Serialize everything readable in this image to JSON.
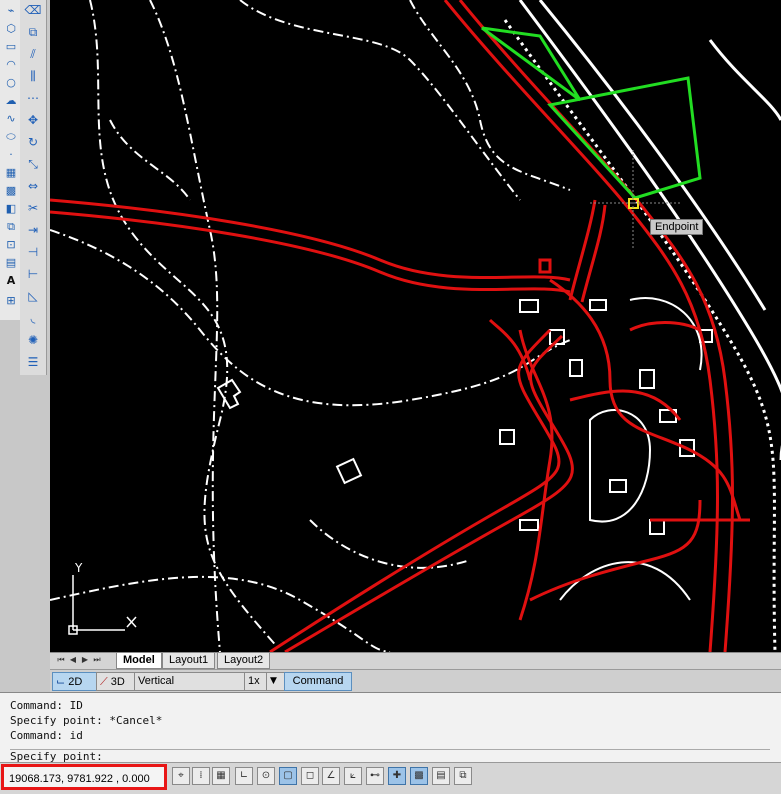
{
  "drawing": {
    "tooltip": "Endpoint",
    "ucs_x": "X",
    "ucs_y": "Y"
  },
  "tabs": {
    "items": [
      "Model",
      "Layout1",
      "Layout2"
    ],
    "active": "Model"
  },
  "viewbar": {
    "btn_2d": "2D",
    "btn_3d": "3D",
    "vertical_exaggeration_label": "Vertical Exaggeration:",
    "exaggeration_value": "1x",
    "command_button": "Command"
  },
  "command_history": [
    "Command: ID",
    "Specify point: *Cancel*",
    "Command: id",
    "Specify point:"
  ],
  "status": {
    "coordinates": "19068.173, 9781.922 , 0.000",
    "highlight_color": "#e81616"
  },
  "colors": {
    "roads": "#e01010",
    "parcel": "#22dd22",
    "background": "#000000",
    "linework": "#ffffff"
  }
}
